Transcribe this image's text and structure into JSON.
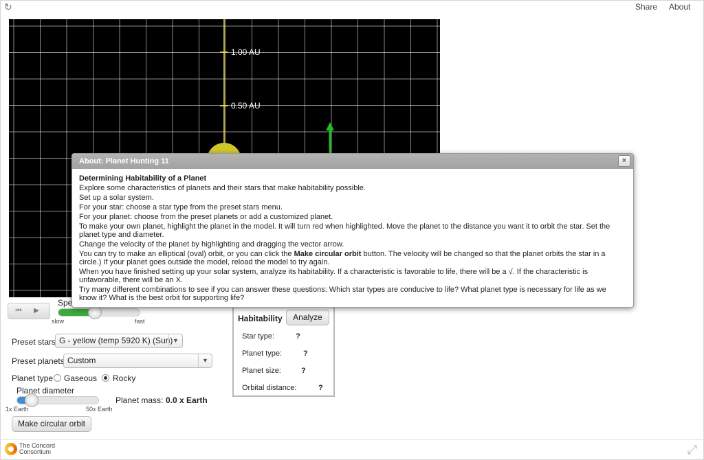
{
  "topbar": {
    "share": "Share",
    "about": "About",
    "reload_icon": "reload-icon"
  },
  "model": {
    "axis_labels": [
      "1.00 AU",
      "0.50 AU"
    ],
    "colors": {
      "background": "#000000",
      "grid": "#ffffff",
      "axis": "#f2e94e",
      "star": "#cfc82a",
      "vector": "#1fbf1f"
    }
  },
  "controls": {
    "speed_label": "Spe",
    "speed_slow": "slow",
    "speed_fast": "fast",
    "speed_level": 0.45,
    "preset_stars_label": "Preset stars",
    "preset_stars_value": "G - yellow (temp 5920 K) (Sun)",
    "preset_planets_label": "Preset planets",
    "preset_planets_value": "Custom",
    "planet_type_label": "Planet type",
    "gaseous": "Gaseous",
    "rocky": "Rocky",
    "selected_type": "Rocky",
    "planet_diameter_label": "Planet diameter",
    "diameter_min": "1x Earth",
    "diameter_max": "50x Earth",
    "diameter_level": 0.18,
    "planet_mass_label": "Planet mass:",
    "planet_mass_value": "0.0 x Earth",
    "make_circular": "Make circular orbit"
  },
  "habitability": {
    "title": "Habitability",
    "analyze": "Analyze",
    "rows": [
      {
        "label": "Star type:",
        "value": "?"
      },
      {
        "label": "Planet type:",
        "value": "?"
      },
      {
        "label": "Planet size:",
        "value": "?"
      },
      {
        "label": "Orbital distance:",
        "value": "?"
      }
    ]
  },
  "footer": {
    "logo_line1": "The Concord",
    "logo_line2": "Consortium"
  },
  "dialog": {
    "title": "About: Planet Hunting 11",
    "close": "×",
    "heading": "Determining Habitability of a Planet",
    "p1": "Explore some characteristics of planets and their stars that make habitability possible.",
    "p2": "Set up a solar system.",
    "p3": "For your star: choose a star type from the preset stars menu.",
    "p4": "For your planet: choose from the preset planets or add a customized planet.",
    "p5": "To make your own planet, highlight the planet in the model. It will turn red when highlighted. Move the planet to the distance you want it to orbit the star. Set the planet type and diameter.",
    "p6": "Change the velocity of the planet by highlighting and dragging the vector arrow.",
    "p7_a": "You can try to make an elliptical (oval) orbit, or you can click the ",
    "p7_b": "Make circular orbit",
    "p7_c": " button. The velocity will be changed so that the planet orbits the star in a circle.) If your planet goes outside the model, reload the model to try again.",
    "p8": "When you have finished setting up your solar system, analyze its habitability. If a characteristic is favorable to life, there will be a √. If the characteristic is unfavorable, there will be an X.",
    "p9": "Try many different combinations to see if you can answer these questions: Which star types are conducive to life? What planet type is necessary for life as we know it? What is the best orbit for supporting life?"
  }
}
